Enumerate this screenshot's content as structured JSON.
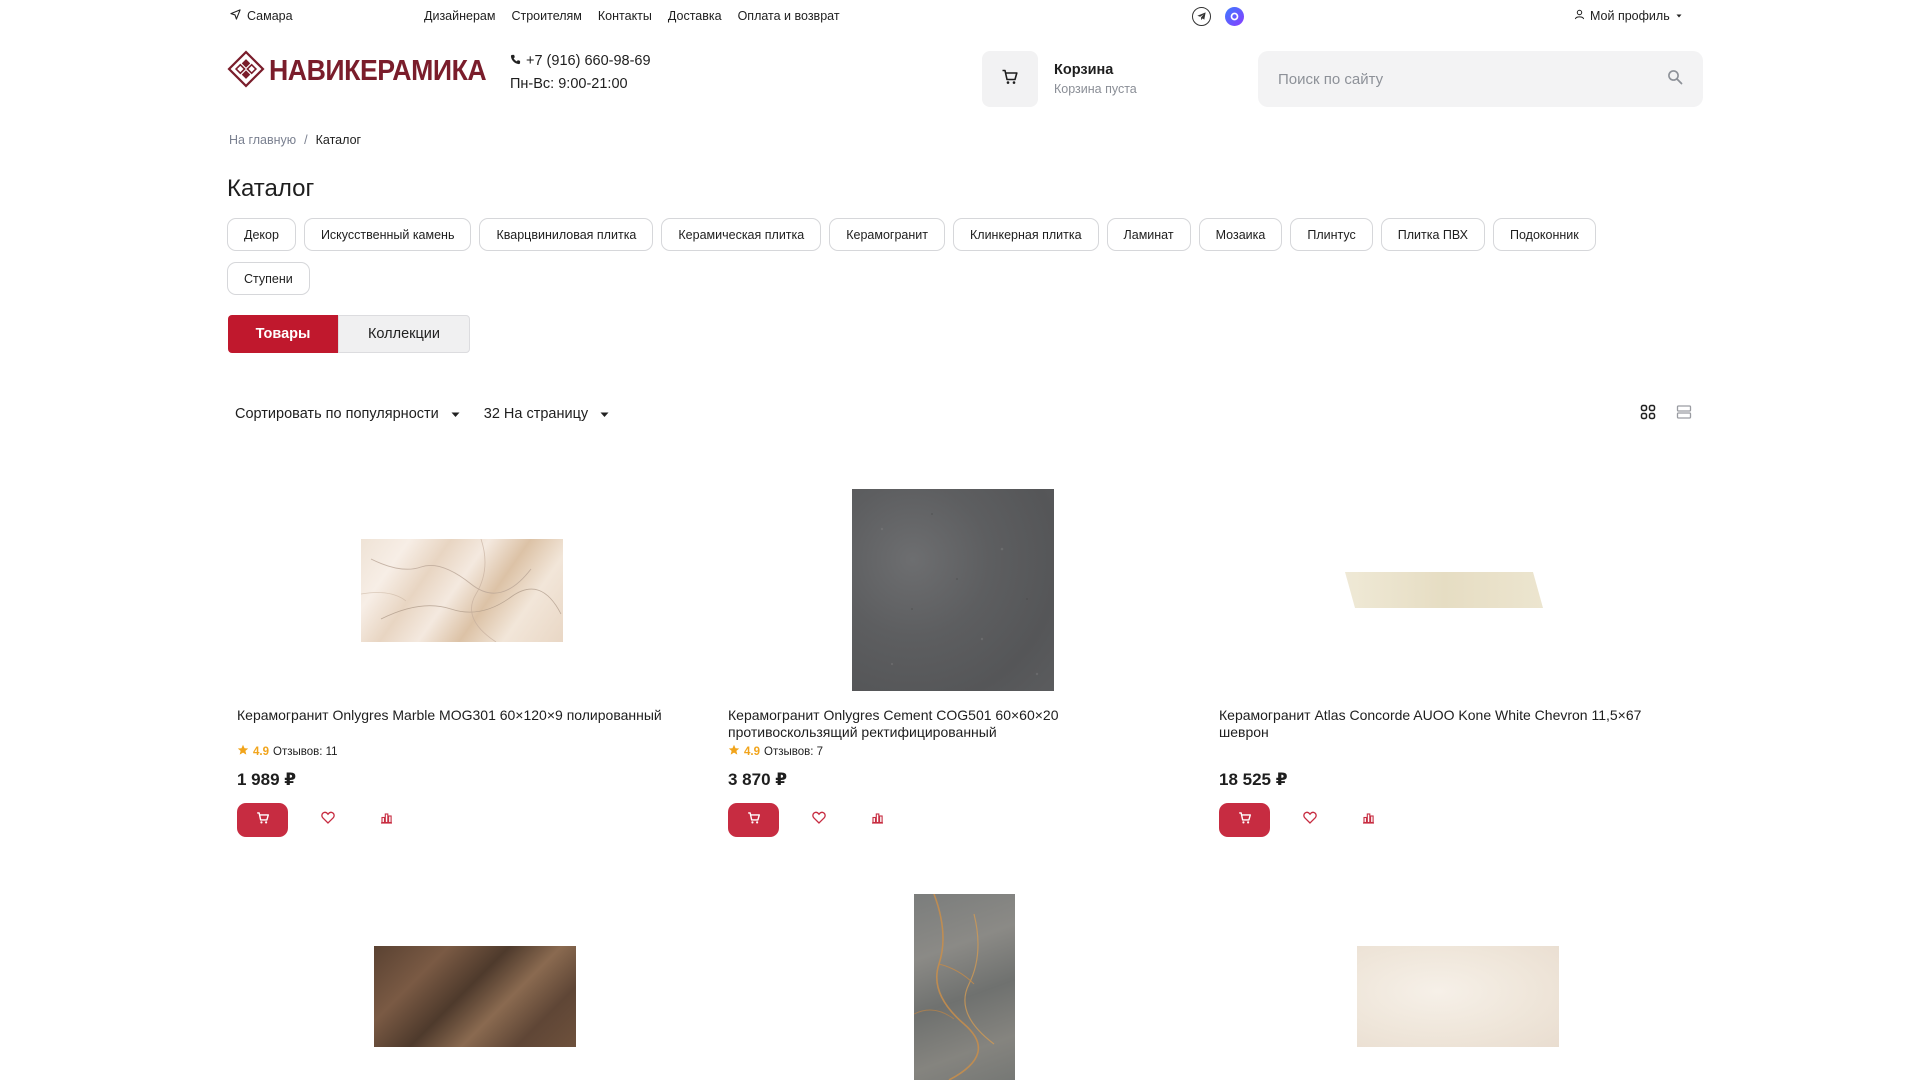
{
  "topbar": {
    "city": "Самара",
    "nav": [
      "Дизайнерам",
      "Строителям",
      "Контакты",
      "Доставка",
      "Оплата и возврат"
    ],
    "profile": "Мой профиль"
  },
  "header": {
    "logo": "НАВИКЕРАМИКА",
    "phone": "+7 (916) 660-98-69",
    "hours": "Пн-Вс: 9:00-21:00",
    "cart_title": "Корзина",
    "cart_sub": "Корзина пуста",
    "search_placeholder": "Поиск по сайту"
  },
  "breadcrumb": {
    "home": "На главную",
    "sep": "/",
    "current": "Каталог"
  },
  "page_title": "Каталог",
  "categories": [
    "Декор",
    "Искусственный камень",
    "Кварцвиниловая плитка",
    "Керамическая плитка",
    "Керамогранит",
    "Клинкерная плитка",
    "Ламинат",
    "Мозаика",
    "Плинтус",
    "Плитка ПВХ",
    "Подоконник",
    "Ступени"
  ],
  "tabs": {
    "active": "Товары",
    "inactive": "Коллекции"
  },
  "sort": {
    "sort_label": "Сортировать по популярности",
    "per_page": "32 На страницу"
  },
  "colors": {
    "accent": "#c72c41",
    "tab_active": "#c0182d",
    "logo": "#7a1d2b",
    "rating": "#f1a41b"
  },
  "products": [
    {
      "name": "Керамогранит Onlygres Marble MOG301 60×120×9 полированный",
      "rating": "4.9",
      "reviews": "Отзывов: 11",
      "price": "1 989 ₽"
    },
    {
      "name": "Керамогранит Onlygres Cement COG501 60×60×20 противоскользящий ректифицированный",
      "rating": "4.9",
      "reviews": "Отзывов: 7",
      "price": "3 870 ₽"
    },
    {
      "name": "Керамогранит Atlas Concorde AUOO Kone White Chevron 11,5×67 шеврон",
      "rating": "",
      "reviews": "",
      "price": "18 525 ₽"
    }
  ]
}
